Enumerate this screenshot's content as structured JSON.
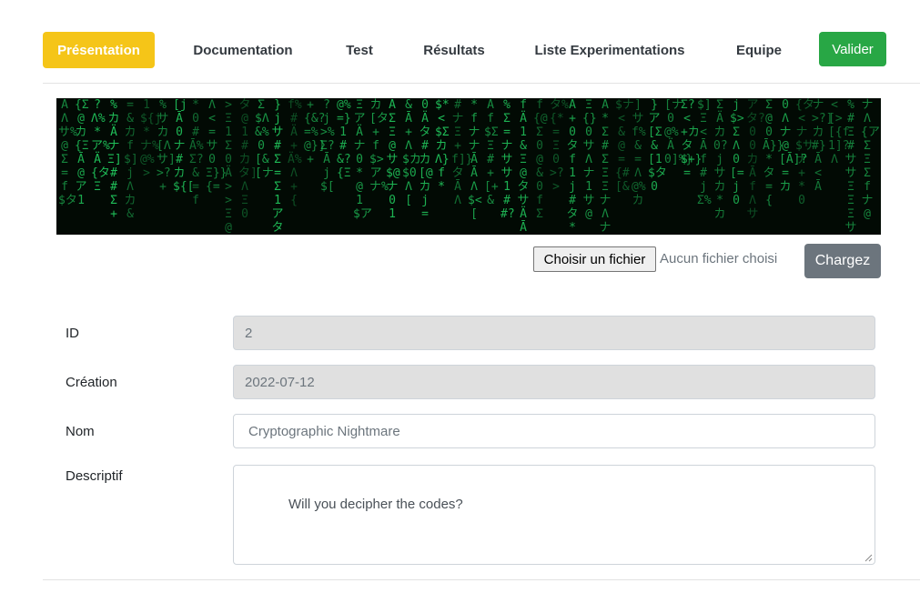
{
  "nav": {
    "presentation": "Présentation",
    "documentation": "Documentation",
    "test": "Test",
    "results": "Résultats",
    "experiments": "Liste Experimentations",
    "team": "Equipe",
    "validate": "Valider"
  },
  "upload": {
    "choose_file": "Choisir un fichier",
    "no_file": "Aucun fichier choisi",
    "submit": "Chargez"
  },
  "form": {
    "id_label": "ID",
    "id_value": "2",
    "created_label": "Création",
    "created_value": "2022-07-12",
    "name_label": "Nom",
    "name_value": "Cryptographic Nightmare",
    "desc_label": "Descriptif",
    "desc_value": "Will you decipher the codes?"
  },
  "colors": {
    "active_tab": "#f5c518",
    "validate": "#28a745",
    "upload": "#6c757d",
    "matrix_green": "#20c25a"
  }
}
